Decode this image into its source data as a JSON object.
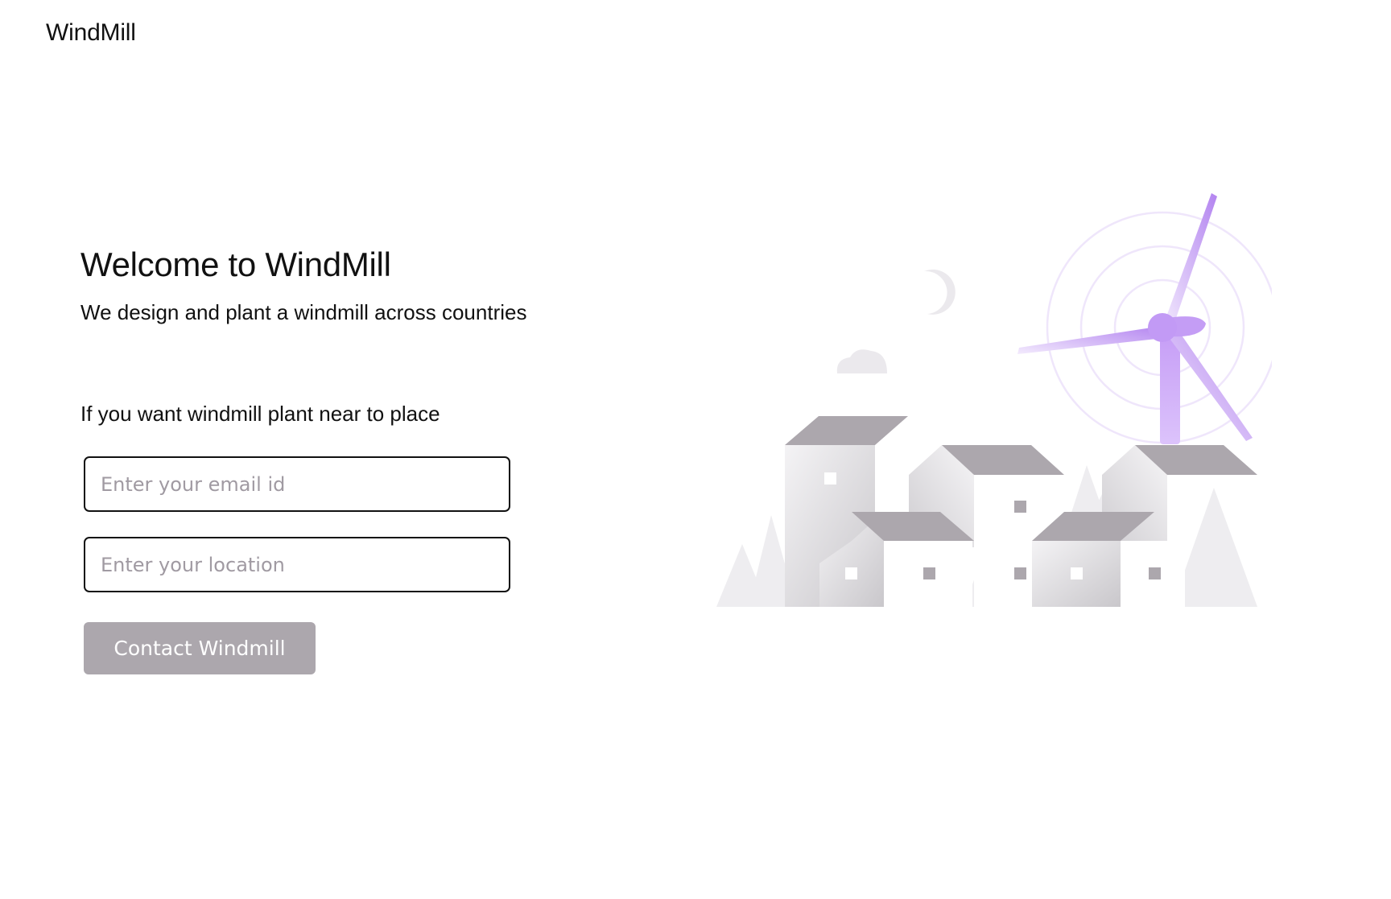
{
  "brand": {
    "name": "WindMill"
  },
  "hero": {
    "title": "Welcome to WindMill",
    "subtitle": "We design and plant a windmill across countries",
    "prompt": "If you want windmill plant near to place"
  },
  "form": {
    "email_placeholder": "Enter your email id",
    "location_placeholder": "Enter your location",
    "submit_label": "Contact Windmill"
  },
  "colors": {
    "button_bg": "#aca7ad",
    "accent": "#b38af2",
    "roof": "#aca7ad"
  },
  "illustration": {
    "icon": "windmill-village-illustration"
  }
}
